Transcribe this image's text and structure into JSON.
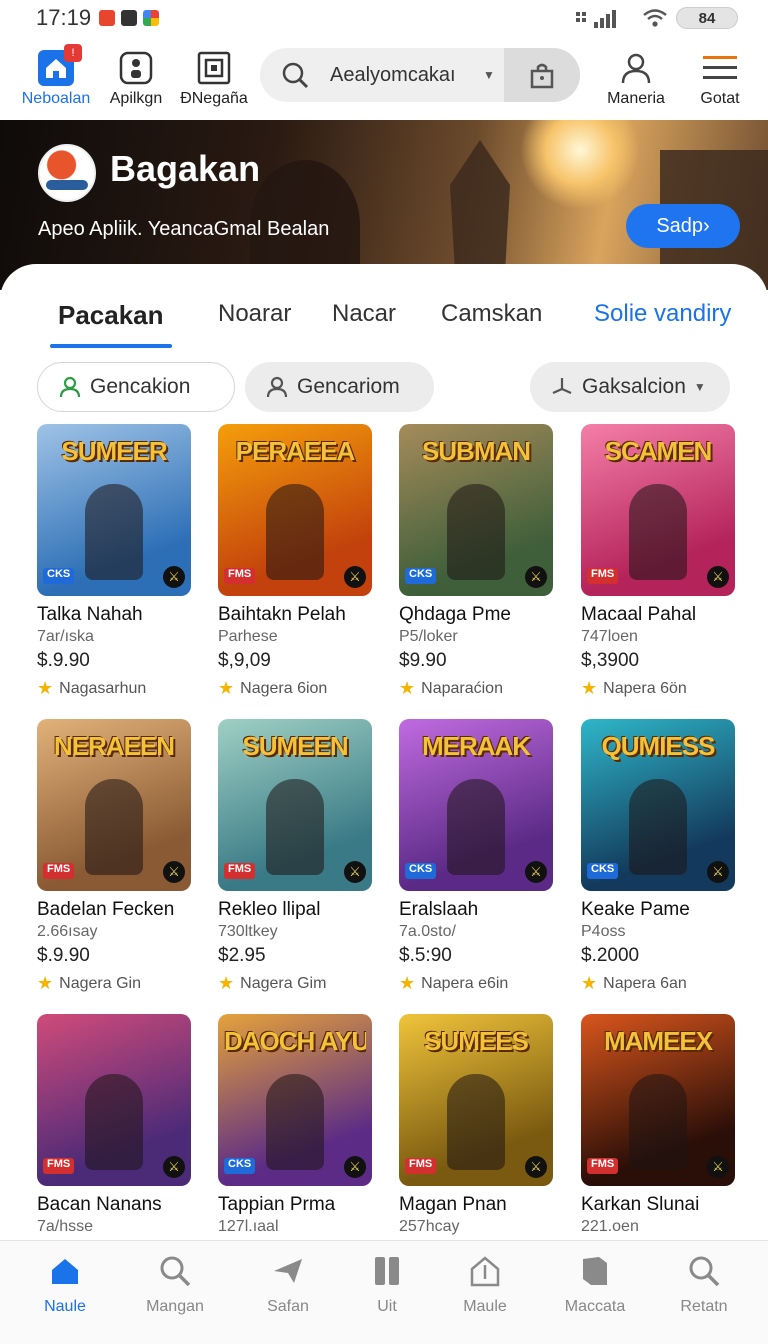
{
  "status_bar": {
    "time": "17:19",
    "battery": "84"
  },
  "top_nav": {
    "items": [
      {
        "label": "Neboalan",
        "icon": "home-icon",
        "badge": "!"
      },
      {
        "label": "Apilkgn",
        "icon": "apps-icon"
      },
      {
        "label": "ÐNegaña",
        "icon": "library-icon"
      }
    ],
    "search": {
      "text": "Aealyomcakaı"
    },
    "right_items": [
      {
        "label": "Maneria",
        "icon": "account-icon"
      },
      {
        "label": "Gotat",
        "icon": "menu-icon"
      }
    ]
  },
  "hero": {
    "title": "Bagakan",
    "subtitle": "Apeo  Apliik.  YeancaGmal Bealan",
    "button": "Sadp›"
  },
  "tabs": [
    {
      "label": "Pacakan",
      "active": true
    },
    {
      "label": "Noarar"
    },
    {
      "label": "Nacar"
    },
    {
      "label": "Camskan"
    },
    {
      "label": "Solie vandiry",
      "link": true
    }
  ],
  "chips": [
    {
      "label": "Gencakion",
      "icon": "person-icon"
    },
    {
      "label": "Gencariom",
      "icon": "person-icon"
    },
    {
      "label": "Gaksalcion",
      "icon": "download-icon"
    }
  ],
  "products": [
    {
      "cover_title": "SUMEER",
      "tag": "CKS",
      "name": "Talka Nahah",
      "dev": "7ar/ıska",
      "price": "$.9.90",
      "rating": "Nagasarhun",
      "colors": [
        "#2d6fb6",
        "#9fc3e6"
      ]
    },
    {
      "cover_title": "PERAEEA",
      "tag": "FMS",
      "name": "Baihtakn Pelah",
      "dev": "Parhese",
      "price": "$,9,09",
      "rating": "Nagera 6ion",
      "colors": [
        "#c2410c",
        "#f59e0b"
      ]
    },
    {
      "cover_title": "SUBMAN",
      "tag": "CKS",
      "name": "Qhdaga Pme",
      "dev": "P5/loker",
      "price": "$9.90",
      "rating": "Naparaćion",
      "colors": [
        "#3f5f3a",
        "#a58b5a"
      ]
    },
    {
      "cover_title": "SCAMEN",
      "tag": "FMS",
      "name": "Macaal Pahal",
      "dev": "747loen",
      "price": "$,3900",
      "rating": "Napera 6ön",
      "colors": [
        "#b4235a",
        "#f47fa8"
      ]
    },
    {
      "cover_title": "NERAEEN",
      "tag": "FMS",
      "name": "Badelan Fecken",
      "dev": "2.66ısay",
      "price": "$.9.90",
      "rating": "Nagera Gin",
      "colors": [
        "#8a5a34",
        "#e2b27a"
      ]
    },
    {
      "cover_title": "SUMEEN",
      "tag": "FMS",
      "name": "Rekleo llipal",
      "dev": "730ltkey",
      "price": "$2.95",
      "rating": "Nagera Gim",
      "colors": [
        "#3a7a86",
        "#9fd0c4"
      ]
    },
    {
      "cover_title": "MERAAK",
      "tag": "CKS",
      "name": "Eralslaah",
      "dev": "7a.0sto/",
      "price": "$.5:90",
      "rating": "Napera e6in",
      "colors": [
        "#5b2a86",
        "#c06be0"
      ]
    },
    {
      "cover_title": "QUMIESS",
      "tag": "CKS",
      "name": "Keake Pame",
      "dev": "P4oss",
      "price": "$.2000",
      "rating": "Napera 6an",
      "colors": [
        "#133a5c",
        "#2fb6c9"
      ]
    },
    {
      "cover_title": "",
      "tag": "FMS",
      "name": "Bacan Nanans",
      "dev": "7a/hsse",
      "price": "",
      "rating": "",
      "colors": [
        "#4b2a78",
        "#d04b7a"
      ]
    },
    {
      "cover_title": "DAOCH AYUAS",
      "tag": "CKS",
      "name": "Tappian Prma",
      "dev": "127l.ıaal",
      "price": "",
      "rating": "",
      "colors": [
        "#5b2b86",
        "#e5a23a"
      ]
    },
    {
      "cover_title": "SUMEES",
      "tag": "FMS",
      "name": "Magan Pnan",
      "dev": "257hcay",
      "price": "",
      "rating": "",
      "colors": [
        "#7a5a10",
        "#f0c43a"
      ]
    },
    {
      "cover_title": "MAMEEX",
      "tag": "FMS",
      "name": "Karkan Slunai",
      "dev": "221.oen",
      "price": "",
      "rating": "",
      "colors": [
        "#2a0e08",
        "#d9561c"
      ]
    }
  ],
  "bottom_nav": [
    {
      "label": "Naule",
      "icon": "home-icon",
      "active": true
    },
    {
      "label": "Mangan",
      "icon": "search-icon"
    },
    {
      "label": "Safan",
      "icon": "send-icon"
    },
    {
      "label": "Uit",
      "icon": "bookmark-icon"
    },
    {
      "label": "Maule",
      "icon": "upload-icon"
    },
    {
      "label": "Maccata",
      "icon": "book-icon"
    },
    {
      "label": "Retatn",
      "icon": "search-icon"
    }
  ],
  "colors": {
    "accent": "#1a73e8",
    "hero_button": "#1f74f0",
    "star": "#f5b400"
  }
}
